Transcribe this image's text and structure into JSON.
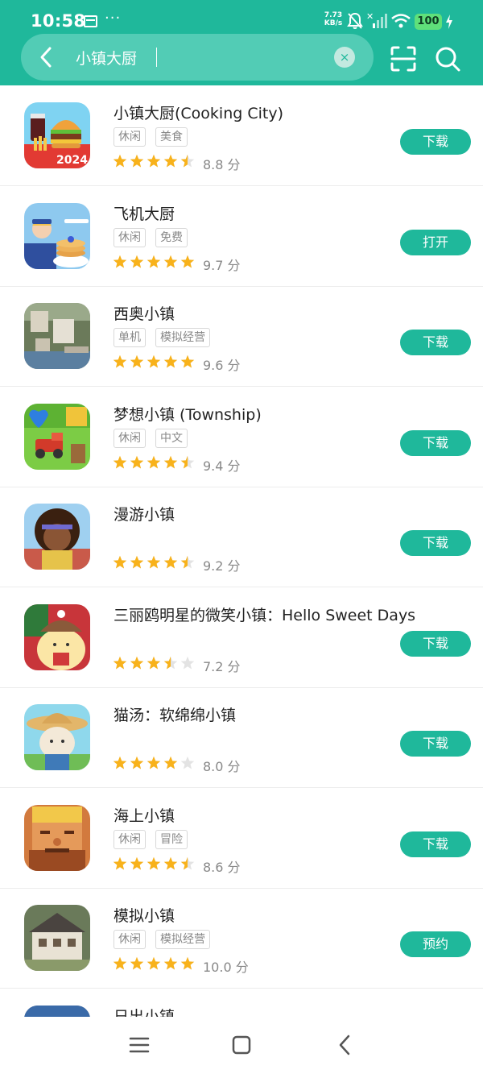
{
  "status_bar": {
    "time": "10:58",
    "dots": "···",
    "net_speed_value": "7.73",
    "net_speed_unit": "KB/s",
    "battery": "100",
    "icons": [
      "calendar-notification-icon",
      "mute-icon",
      "signal-icon",
      "wifi-icon",
      "charging-icon"
    ]
  },
  "search": {
    "query": "小镇大厨",
    "clear_label": "×"
  },
  "colors": {
    "brand": "#1fb89b",
    "star": "#f8b21b",
    "star_empty": "#e3e3e3"
  },
  "results": [
    {
      "name": "小镇大厨(Cooking City)",
      "tags": [
        "休闲",
        "美食"
      ],
      "rating": 4.5,
      "score": "8.8 分",
      "action": "下载"
    },
    {
      "name": "飞机大厨",
      "tags": [
        "休闲",
        "免费"
      ],
      "rating": 5,
      "score": "9.7 分",
      "action": "打开"
    },
    {
      "name": "西奥小镇",
      "tags": [
        "单机",
        "模拟经营"
      ],
      "rating": 5,
      "score": "9.6 分",
      "action": "下载"
    },
    {
      "name": "梦想小镇 (Township)",
      "tags": [
        "休闲",
        "中文"
      ],
      "rating": 4.5,
      "score": "9.4 分",
      "action": "下载"
    },
    {
      "name": "漫游小镇",
      "tags": [],
      "rating": 4.5,
      "score": "9.2 分",
      "action": "下载"
    },
    {
      "name": "三丽鸥明星的微笑小镇：Hello Sweet Days",
      "tags": [],
      "rating": 3.5,
      "score": "7.2 分",
      "action": "下载"
    },
    {
      "name": "猫汤：软绵绵小镇",
      "tags": [],
      "rating": 4,
      "score": "8.0 分",
      "action": "下载"
    },
    {
      "name": "海上小镇",
      "tags": [
        "休闲",
        "冒险"
      ],
      "rating": 4.5,
      "score": "8.6 分",
      "action": "下载"
    },
    {
      "name": "模拟小镇",
      "tags": [
        "休闲",
        "模拟经营"
      ],
      "rating": 5,
      "score": "10.0 分",
      "action": "预约"
    },
    {
      "name": "日出小镇",
      "tags": [],
      "rating": 0,
      "score": "",
      "action": ""
    }
  ],
  "nav_bar": {
    "buttons": [
      "menu-icon",
      "home-icon",
      "back-icon"
    ]
  }
}
